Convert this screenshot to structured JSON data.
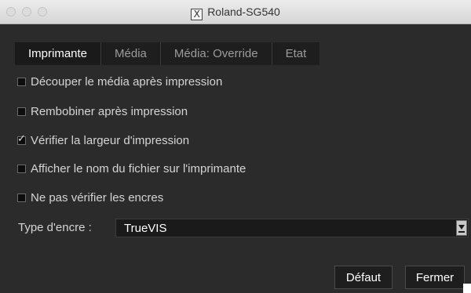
{
  "window": {
    "title": "Roland-SG540",
    "title_icon": "x11-icon"
  },
  "tabs": [
    {
      "label": "Imprimante",
      "active": true
    },
    {
      "label": "Média",
      "active": false
    },
    {
      "label": "Média: Override",
      "active": false
    },
    {
      "label": "Etat",
      "active": false
    }
  ],
  "options": [
    {
      "label": "Découper le média après impression",
      "checked": false
    },
    {
      "label": "Rembobiner après impression",
      "checked": false
    },
    {
      "label": "Vérifier la largeur d'impression",
      "checked": true
    },
    {
      "label": "Afficher le nom du fichier sur l'imprimante",
      "checked": false
    },
    {
      "label": "Ne pas vérifier les encres",
      "checked": false
    }
  ],
  "ink_type": {
    "label": "Type d'encre  :",
    "value": "TrueVIS"
  },
  "buttons": {
    "default_label": "Défaut",
    "close_label": "Fermer"
  },
  "colors": {
    "background": "#2b2b2b",
    "titlebar": "#e0e0e0",
    "text": "#d4d4d4",
    "tab_active": "#1a1a1a"
  }
}
